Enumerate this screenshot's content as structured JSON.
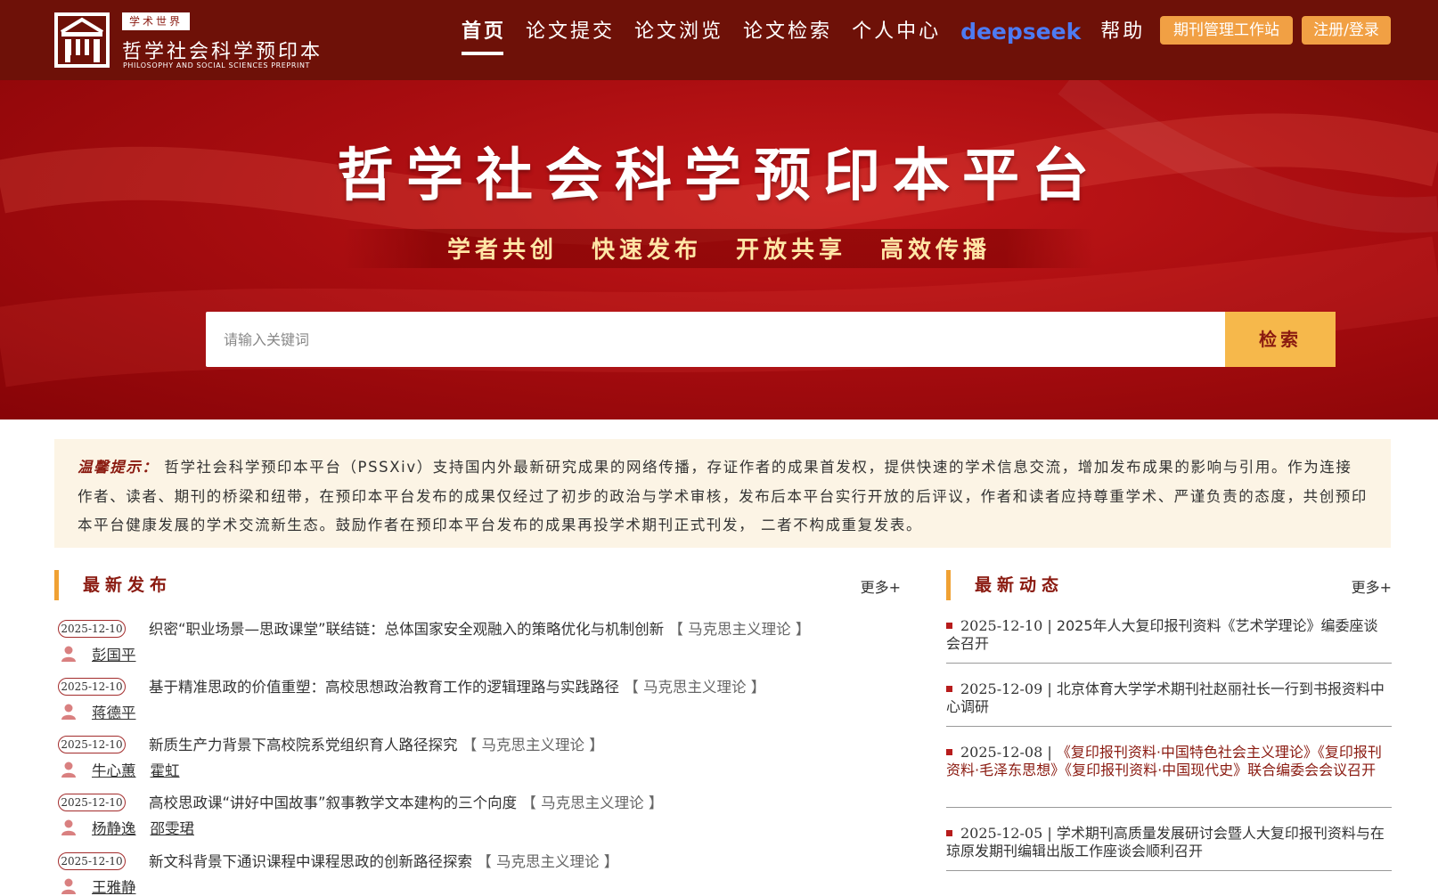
{
  "header": {
    "logo_tag": "学术世界",
    "logo_cn": "哲学社会科学预印本",
    "logo_en": "PHILOSOPHY AND SOCIAL SCIENCES PREPRINT",
    "nav": [
      {
        "label": "首页",
        "active": true
      },
      {
        "label": "论文提交"
      },
      {
        "label": "论文浏览"
      },
      {
        "label": "论文检索"
      },
      {
        "label": "个人中心"
      }
    ],
    "deepseek": "deepseek",
    "help": "帮助",
    "journal_btn": "期刊管理工作站",
    "login_btn": "注册/登录"
  },
  "hero": {
    "title": "哲学社会科学预印本平台",
    "slogans": [
      "学者共创",
      "快速发布",
      "开放共享",
      "高效传播"
    ],
    "search_placeholder": "请输入关键词",
    "search_btn": "检索"
  },
  "notice": {
    "label": "温馨提示：",
    "text": "哲学社会科学预印本平台（PSSXiv）支持国内外最新研究成果的网络传播，存证作者的成果首发权，提供快速的学术信息交流，增加发布成果的影响与引用。作为连接作者、读者、期刊的桥梁和纽带，在预印本平台发布的成果仅经过了初步的政治与学术审核，发布后本平台实行开放的后评议，作者和读者应持尊重学术、严谨负责的态度，共创预印本平台健康发展的学术交流新生态。鼓励作者在预印本平台发布的成果再投学术期刊正式刊发， 二者不构成重复发表。"
  },
  "latest": {
    "title": "最新发布",
    "more": "更多+",
    "items": [
      {
        "date": "2025-12-10",
        "title": "织密“职业场景—思政课堂”联结链：总体国家安全观融入的策略优化与机制创新",
        "category": "【 马克思主义理论 】",
        "authors": [
          "彭国平"
        ]
      },
      {
        "date": "2025-12-10",
        "title": "基于精准思政的价值重塑：高校思想政治教育工作的逻辑理路与实践路径",
        "category": "【 马克思主义理论 】",
        "authors": [
          "蒋德平"
        ]
      },
      {
        "date": "2025-12-10",
        "title": "新质生产力背景下高校院系党组织育人路径探究",
        "category": "【 马克思主义理论 】",
        "authors": [
          "牛心蕙",
          "霍虹"
        ]
      },
      {
        "date": "2025-12-10",
        "title": "高校思政课“讲好中国故事”叙事教学文本建构的三个向度",
        "category": "【 马克思主义理论 】",
        "authors": [
          "杨静逸",
          "邵雯珺"
        ]
      },
      {
        "date": "2025-12-10",
        "title": "新文科背景下通识课程中课程思政的创新路径探索",
        "category": "【 马克思主义理论 】",
        "authors": [
          "王雅静"
        ]
      }
    ]
  },
  "news": {
    "title": "最新动态",
    "more": "更多+",
    "items": [
      {
        "date": "2025-12-10",
        "sep": " | ",
        "title": "2025年人大复印报刊资料《艺术学理论》编委座谈会召开"
      },
      {
        "date": "2025-12-09",
        "sep": " | ",
        "title": "北京体育大学学术期刊社赵丽社长一行到书报资料中心调研"
      },
      {
        "date": "2025-12-08",
        "sep": " | ",
        "title": "《复印报刊资料·中国特色社会主义理论》《复印报刊资料·毛泽东思想》《复印报刊资料·中国现代史》联合编委会会议召开",
        "highlight": true
      },
      {
        "date": "2025-12-05",
        "sep": " | ",
        "title": "学术期刊高质量发展研讨会暨人大复印报刊资料与在琼原发期刊编辑出版工作座谈会顺利召开"
      }
    ]
  },
  "colors": {
    "topbar": "#6e1108",
    "hero_red": "#a90d10",
    "accent_orange": "#f1a044",
    "title_red": "#8a1a10",
    "deepseek_blue": "#4d7bf3"
  }
}
